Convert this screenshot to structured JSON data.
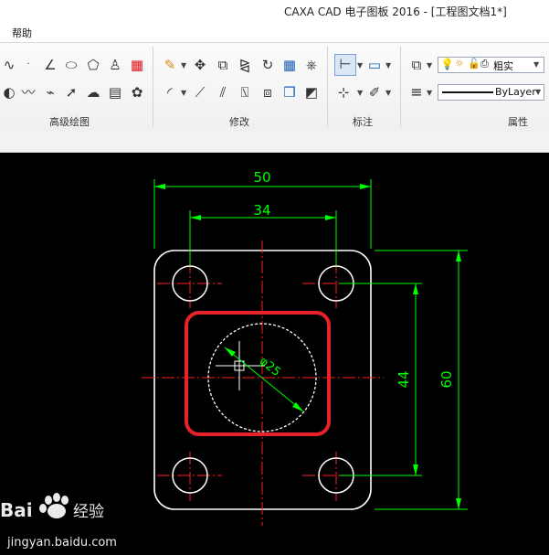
{
  "window": {
    "title": "CAXA CAD 电子图板 2016 - [工程图文档1*]"
  },
  "menu": {
    "help": "帮助"
  },
  "ribbon": {
    "groups": [
      {
        "label": "高级绘图"
      },
      {
        "label": "修改"
      },
      {
        "label": "标注"
      },
      {
        "label": "属性"
      }
    ],
    "line_width_combo": "粗实",
    "linetype_combo": "ByLayer"
  },
  "drawing": {
    "dimensions": {
      "overall_width": "50",
      "hole_spacing_x": "34",
      "hole_spacing_y": "44",
      "overall_height": "60",
      "diameter": "φ25"
    },
    "colors": {
      "background": "#000000",
      "outline": "#ffffff",
      "centerline": "#ff0000",
      "dimension": "#00ff00",
      "highlight": "#e8222a"
    }
  },
  "watermark": {
    "brand": "Bai",
    "brand_cn": "经验",
    "url": "jingyan.baidu.com"
  }
}
